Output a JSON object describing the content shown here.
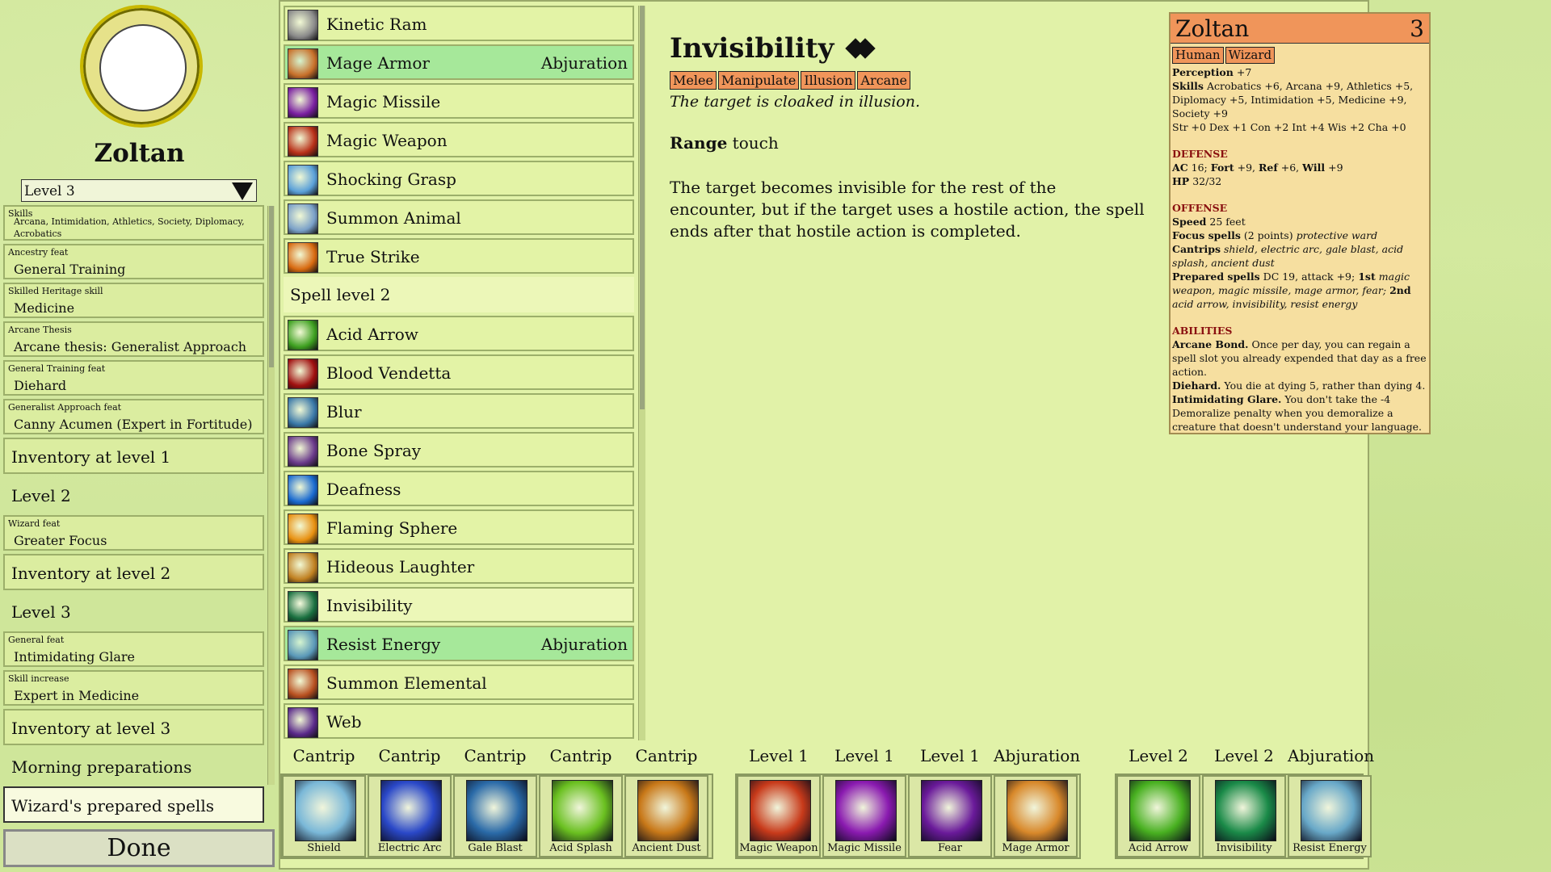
{
  "character": {
    "name": "Zoltan",
    "level_select": "Level 3"
  },
  "build_items": [
    {
      "kind": "small",
      "category": "Skills",
      "value": "Arcana, Intimidation, Athletics, Society, Diplomacy, Acrobatics"
    },
    {
      "kind": "small",
      "category": "Ancestry feat",
      "value": "General Training"
    },
    {
      "kind": "small",
      "category": "Skilled Heritage skill",
      "value": "Medicine"
    },
    {
      "kind": "small",
      "category": "Arcane Thesis",
      "value": "Arcane thesis: Generalist Approach"
    },
    {
      "kind": "small",
      "category": "General Training feat",
      "value": "Diehard"
    },
    {
      "kind": "small",
      "category": "Generalist Approach feat",
      "value": "Canny Acumen (Expert in Fortitude)"
    },
    {
      "kind": "big",
      "title": "Inventory at level 1"
    },
    {
      "kind": "plain",
      "title": "Level 2"
    },
    {
      "kind": "small",
      "category": "Wizard feat",
      "value": "Greater Focus"
    },
    {
      "kind": "big",
      "title": "Inventory at level 2"
    },
    {
      "kind": "plain",
      "title": "Level 3"
    },
    {
      "kind": "small",
      "category": "General feat",
      "value": "Intimidating Glare"
    },
    {
      "kind": "small",
      "category": "Skill increase",
      "value": "Expert in Medicine"
    },
    {
      "kind": "big",
      "title": "Inventory at level 3"
    },
    {
      "kind": "plain",
      "title": "Morning preparations"
    },
    {
      "kind": "active",
      "title": "Wizard's prepared spells"
    }
  ],
  "done_label": "Done",
  "spells": [
    {
      "name": "Kinetic Ram",
      "school": "",
      "state": "",
      "color": "#8a8a8a"
    },
    {
      "name": "Mage Armor",
      "school": "Abjuration",
      "state": "sel",
      "color": "#c8702a"
    },
    {
      "name": "Magic Missile",
      "school": "",
      "state": "",
      "color": "#7a1fa0"
    },
    {
      "name": "Magic Weapon",
      "school": "",
      "state": "",
      "color": "#b83018"
    },
    {
      "name": "Shocking Grasp",
      "school": "",
      "state": "",
      "color": "#5aa0d8"
    },
    {
      "name": "Summon Animal",
      "school": "",
      "state": "",
      "color": "#7aa0c8"
    },
    {
      "name": "True Strike",
      "school": "",
      "state": "",
      "color": "#d86a10"
    },
    {
      "header": "Spell level 2"
    },
    {
      "name": "Acid Arrow",
      "school": "",
      "state": "",
      "color": "#3ea020"
    },
    {
      "name": "Blood Vendetta",
      "school": "",
      "state": "",
      "color": "#a01010"
    },
    {
      "name": "Blur",
      "school": "",
      "state": "",
      "color": "#3a78a8"
    },
    {
      "name": "Bone Spray",
      "school": "",
      "state": "",
      "color": "#6a3a8a"
    },
    {
      "name": "Deafness",
      "school": "",
      "state": "",
      "color": "#1a6ad0"
    },
    {
      "name": "Flaming Sphere",
      "school": "",
      "state": "",
      "color": "#e89010"
    },
    {
      "name": "Hideous Laughter",
      "school": "",
      "state": "",
      "color": "#c08020"
    },
    {
      "name": "Invisibility",
      "school": "",
      "state": "inv",
      "color": "#1a7040"
    },
    {
      "name": "Resist Energy",
      "school": "Abjuration",
      "state": "sel",
      "color": "#5a98b8"
    },
    {
      "name": "Summon Elemental",
      "school": "",
      "state": "",
      "color": "#b85020"
    },
    {
      "name": "Web",
      "school": "",
      "state": "",
      "color": "#5a2a8a"
    }
  ],
  "detail": {
    "title": "Invisibility",
    "traits": [
      "Melee",
      "Manipulate",
      "Illusion",
      "Arcane"
    ],
    "flavor": "The target is cloaked in illusion.",
    "range_label": "Range",
    "range_value": "touch",
    "description": "The target becomes invisible for the rest of the encounter, but if the target uses a hostile action, the spell ends after that hostile action is completed."
  },
  "stat": {
    "name": "Zoltan",
    "level": "3",
    "tags": [
      "Human",
      "Wizard"
    ],
    "perception_label": "Perception",
    "perception": "+7",
    "skills_label": "Skills",
    "skills": "Acrobatics +6, Arcana +9, Athletics +5, Diplomacy +5, Intimidation +5, Medicine +9, Society +9",
    "abilities": "Str +0 Dex +1 Con +2 Int +4 Wis +2 Cha +0",
    "defense_header": "DEFENSE",
    "ac_label": "AC",
    "ac": "16;",
    "fort_label": "Fort",
    "fort": "+9,",
    "ref_label": "Ref",
    "ref": "+6,",
    "will_label": "Will",
    "will": "+9",
    "hp_label": "HP",
    "hp": "32/32",
    "offense_header": "OFFENSE",
    "speed_label": "Speed",
    "speed": "25 feet",
    "focus_label": "Focus spells",
    "focus": "(2 points)",
    "focus_spell": "protective ward",
    "cantrips_label": "Cantrips",
    "cantrips": "shield, electric arc, gale blast, acid splash, ancient dust",
    "prepared_label": "Prepared spells",
    "prepared_pre": "DC 19, attack +9;",
    "prepared_1st_label": "1st",
    "prepared_1st": "magic weapon, magic missile, mage armor, fear;",
    "prepared_2nd_label": "2nd",
    "prepared_2nd": "acid arrow, invisibility, resist energy",
    "abilities_header": "ABILITIES",
    "ab1_name": "Arcane Bond.",
    "ab1": "Once per day, you can regain a spell slot you already expended that day as a free action.",
    "ab2_name": "Diehard.",
    "ab2": "You die at dying 5, rather than dying 4.",
    "ab3_name": "Intimidating Glare.",
    "ab3": "You don't take the -4 Demoralize penalty when you demoralize a creature that doesn't understand your language."
  },
  "slots": [
    {
      "label": "Cantrip",
      "name": "Shield",
      "color": "#7ab8d8"
    },
    {
      "label": "Cantrip",
      "name": "Electric Arc",
      "color": "#2a48c8"
    },
    {
      "label": "Cantrip",
      "name": "Gale Blast",
      "color": "#2a6aa8"
    },
    {
      "label": "Cantrip",
      "name": "Acid Splash",
      "color": "#6ac020"
    },
    {
      "label": "Cantrip",
      "name": "Ancient Dust",
      "color": "#c87818"
    },
    {
      "label": "Level 1",
      "name": "Magic Weapon",
      "color": "#c83a1a"
    },
    {
      "label": "Level 1",
      "name": "Magic Missile",
      "color": "#8a1ab0"
    },
    {
      "label": "Level 1",
      "name": "Fear",
      "color": "#6a1a9a"
    },
    {
      "label": "Abjuration",
      "name": "Mage Armor",
      "color": "#d8882a"
    },
    {
      "label": "Level 2",
      "name": "Acid Arrow",
      "color": "#48b020"
    },
    {
      "label": "Level 2",
      "name": "Invisibility",
      "color": "#1a8a48"
    },
    {
      "label": "Abjuration",
      "name": "Resist Energy",
      "color": "#68a8c8"
    }
  ]
}
